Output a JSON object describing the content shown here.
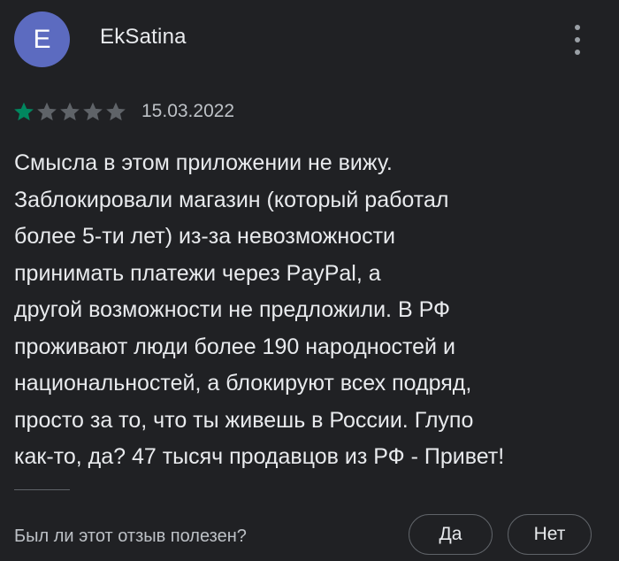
{
  "author": {
    "avatar_letter": "E",
    "name": "EkSatina",
    "avatar_color": "#5c6bc0"
  },
  "menu_icon": "more-vert-icon",
  "rating": {
    "value": 1,
    "max": 5,
    "filled_color": "#01875f",
    "empty_color": "#5f6368"
  },
  "date": "15.03.2022",
  "review_lines": [
    "Смысла в этом приложении не вижу.",
    "Заблокировали магазин (который работал",
    "более 5-ти лет) из-за невозможности",
    "принимать платежи через PayPal, а",
    "другой возможности не предложили. В РФ",
    "проживают люди более 190 народностей и",
    "национальностей, а блокируют всех подряд,",
    "просто за то, что ты живешь в России. Глупо",
    "как-то, да? 47 тысяч продавцов из РФ - Привет!"
  ],
  "helpful": {
    "question": "Был ли этот отзыв полезен?",
    "yes_label": "Да",
    "no_label": "Нет"
  }
}
